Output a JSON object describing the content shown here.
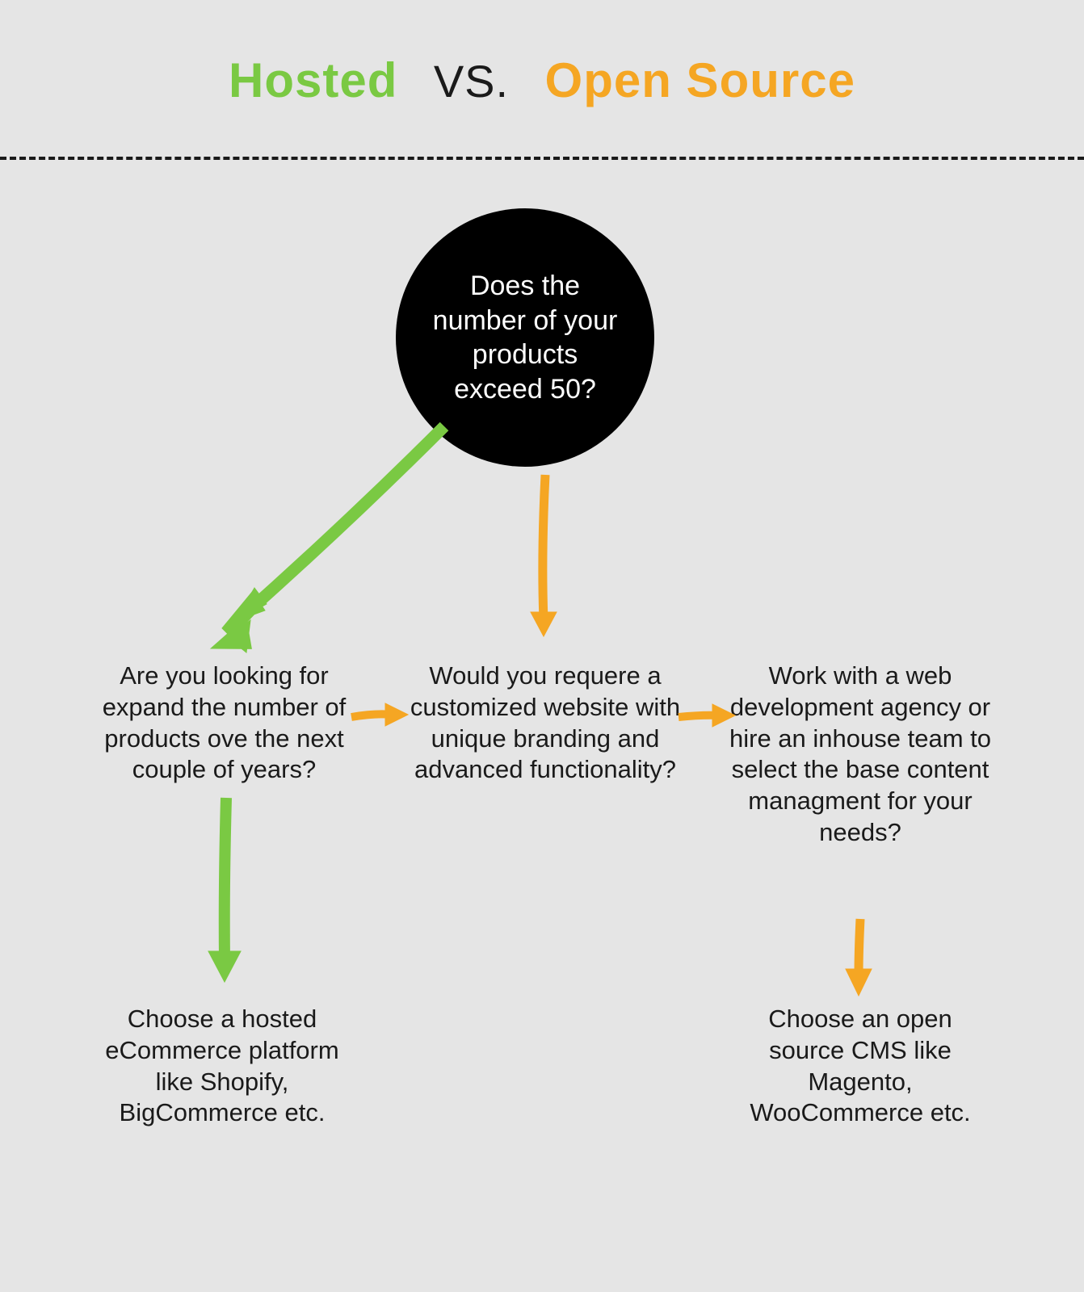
{
  "header": {
    "hosted": "Hosted",
    "vs": "VS.",
    "opensource": "Open Source"
  },
  "nodes": {
    "start": "Does the number of your products exceed 50?",
    "expand": "Are you looking for expand the number of products ove the next couple of years?",
    "custom": "Would you requere a customized website with unique branding and advanced functionality?",
    "agency": "Work with a web development agency or hire an inhouse team to select the base content managment for your needs?",
    "hosted_result": "Choose a hosted eCommerce platform like Shopify, BigCommerce etc.",
    "opensource_result": "Choose an open source CMS like Magento, WooCommerce etc."
  },
  "colors": {
    "hosted": "#7ac943",
    "opensource": "#f5a623",
    "bg": "#e5e5e5",
    "start_bg": "#000000"
  }
}
